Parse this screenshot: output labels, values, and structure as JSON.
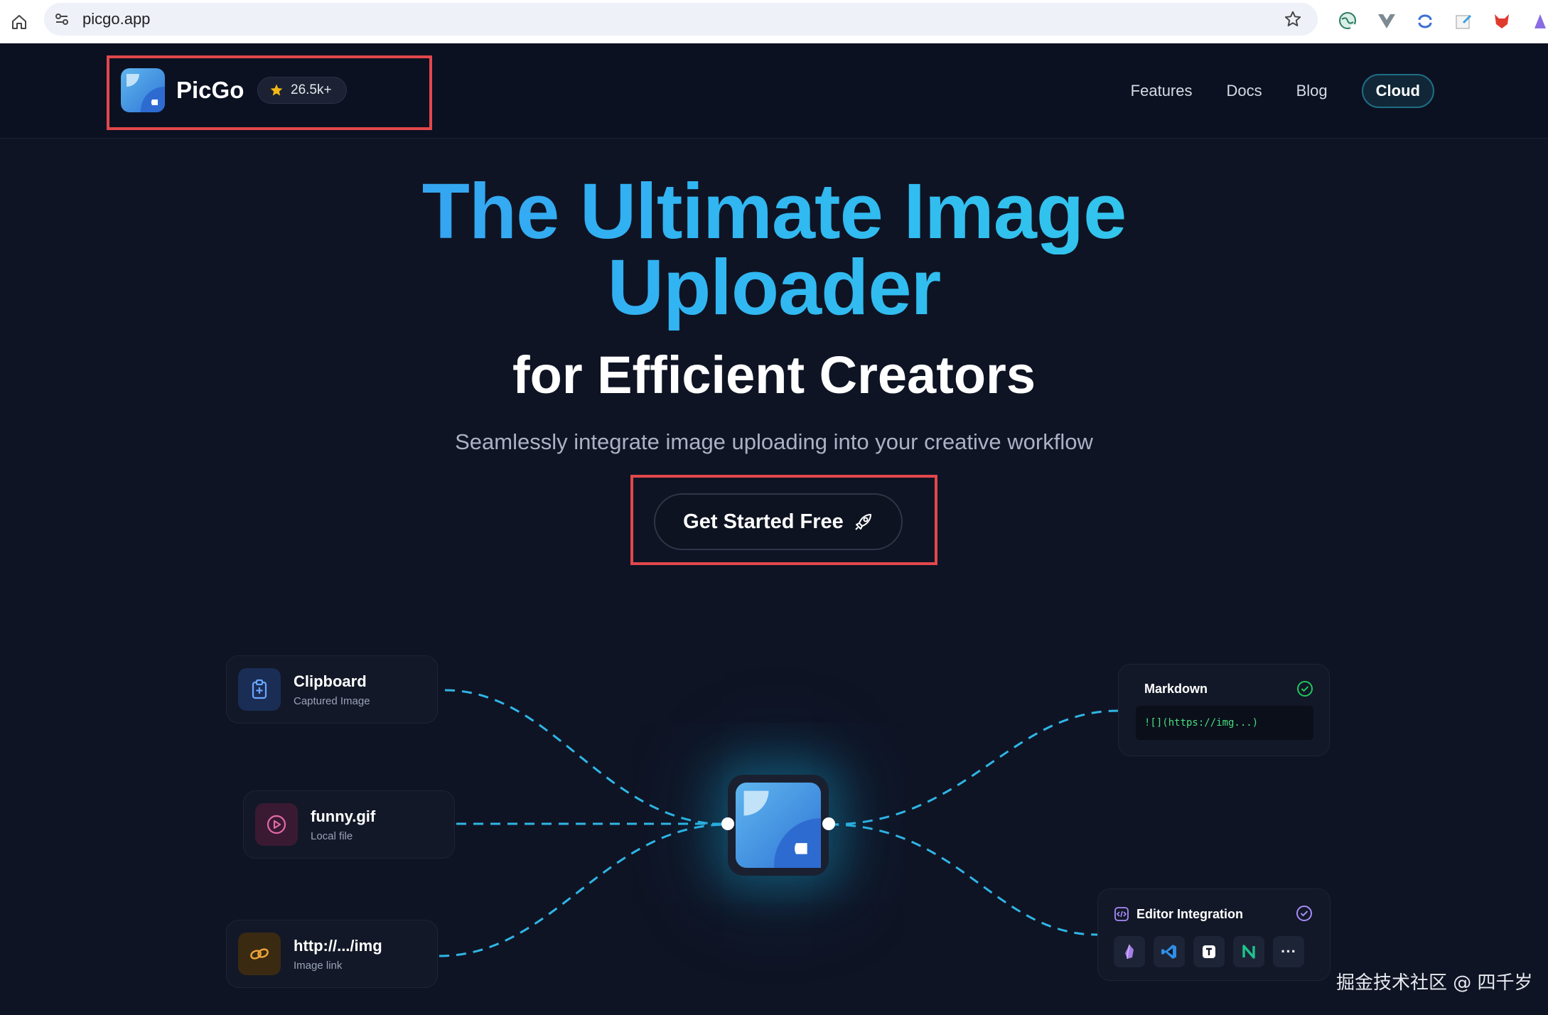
{
  "browser": {
    "url": "picgo.app"
  },
  "nav": {
    "brand": "PicGo",
    "stars": "26.5k+",
    "links": [
      "Features",
      "Docs",
      "Blog"
    ],
    "cloud": "Cloud"
  },
  "hero": {
    "line1": "The Ultimate Image",
    "line2": "Uploader",
    "subtitle": "for Efficient Creators",
    "description": "Seamlessly integrate image uploading into your creative workflow",
    "cta": "Get Started Free"
  },
  "sources": [
    {
      "title": "Clipboard",
      "subtitle": "Captured Image",
      "icon": "clipboard-plus-icon"
    },
    {
      "title": "funny.gif",
      "subtitle": "Local file",
      "icon": "play-circle-icon"
    },
    {
      "title": "http://.../img",
      "subtitle": "Image link",
      "icon": "link-icon"
    }
  ],
  "outputs": {
    "markdown": {
      "title": "Markdown",
      "code": "![](https://img...)"
    },
    "editor": {
      "title": "Editor Integration",
      "tools": [
        "obsidian-icon",
        "vscode-icon",
        "typora-icon",
        "notion-icon",
        "more-icon"
      ],
      "more": "···"
    }
  },
  "colors": {
    "background": "#0f1424",
    "accent": "#32c5f0",
    "highlight_box": "#e2474c",
    "line": "#2fb6e6"
  },
  "watermark": "掘金技术社区 @ 四千岁"
}
